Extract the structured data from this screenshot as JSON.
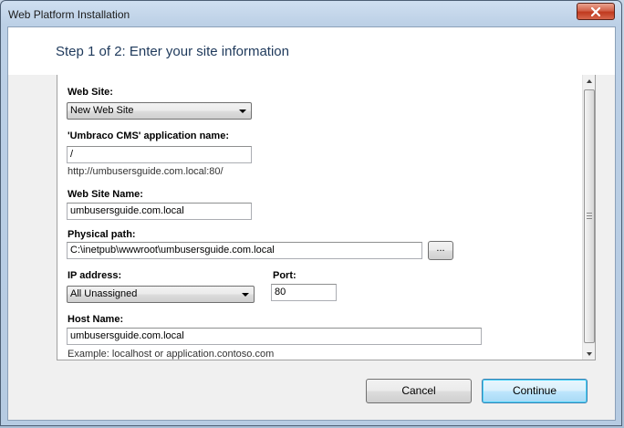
{
  "window": {
    "title": "Web Platform Installation"
  },
  "step": {
    "title": "Step 1 of 2: Enter your site information"
  },
  "form": {
    "web_site": {
      "label": "Web Site:",
      "value": "New Web Site"
    },
    "app_name": {
      "label": "'Umbraco CMS' application name:",
      "value": "/",
      "url": "http://umbusersguide.com.local:80/"
    },
    "site_name": {
      "label": "Web Site Name:",
      "value": "umbusersguide.com.local"
    },
    "physical_path": {
      "label": "Physical path:",
      "value": "C:\\inetpub\\wwwroot\\umbusersguide.com.local",
      "browse_label": "..."
    },
    "ip_address": {
      "label": "IP address:",
      "value": "All Unassigned"
    },
    "port": {
      "label": "Port:",
      "value": "80"
    },
    "host_name": {
      "label": "Host Name:",
      "value": "umbusersguide.com.local",
      "example": "Example: localhost or application.contoso.com"
    }
  },
  "buttons": {
    "cancel": "Cancel",
    "continue": "Continue"
  },
  "icons": {
    "close": "close-icon",
    "dropdown": "chevron-down-icon",
    "scroll_up": "arrow-up-icon",
    "scroll_down": "arrow-down-icon"
  },
  "colors": {
    "title_blue": "#1e395b",
    "close_red": "#c0391e",
    "default_button": "#3c7fb1"
  }
}
